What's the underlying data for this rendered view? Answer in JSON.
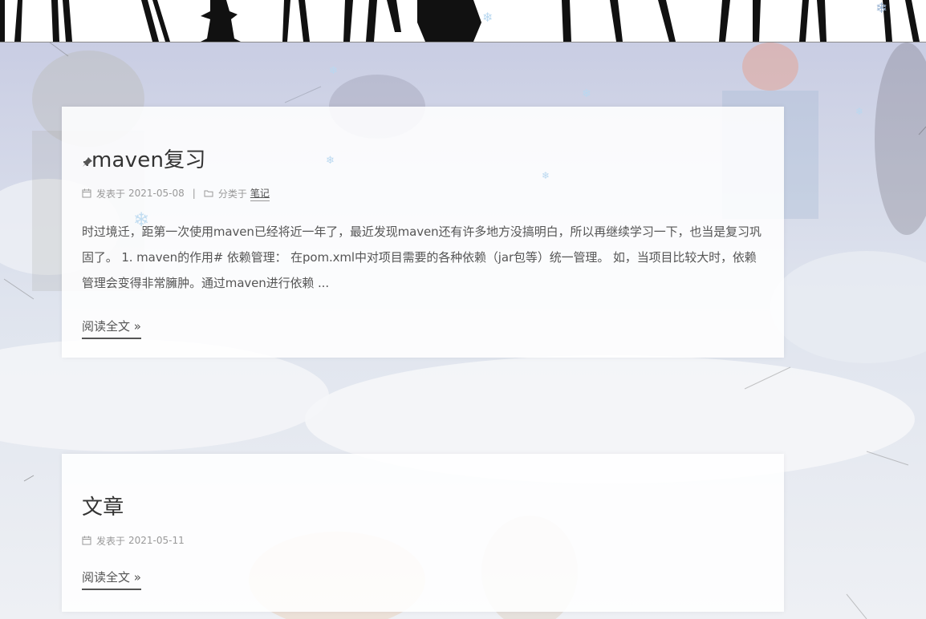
{
  "posts": [
    {
      "title": "maven复习",
      "pinned": true,
      "date_label": "发表于",
      "date": "2021-05-08",
      "category_label": "分类于",
      "category": "笔记",
      "excerpt": "时过境迁，距第一次使用maven已经将近一年了，最近发现maven还有许多地方没搞明白，所以再继续学习一下，也当是复习巩固了。 1. maven的作用# 依赖管理： 在pom.xml中对项目需要的各种依赖（jar包等）统一管理。 如，当项目比较大时，依赖管理会变得非常臃肿。通过maven进行依赖 ...",
      "read_more": "阅读全文 »"
    },
    {
      "title": "文章",
      "pinned": false,
      "date_label": "发表于",
      "date": "2021-05-11",
      "read_more": "阅读全文 »"
    }
  ],
  "icons": {
    "pin": "pushpin-icon",
    "calendar": "calendar-icon",
    "folder": "folder-icon",
    "snowflake": "snowflake-icon"
  },
  "colors": {
    "text": "#555555",
    "title": "#333333",
    "meta": "#999999",
    "snow": "#b9d8f0"
  },
  "meta_separator": "|",
  "snowflake_glyph": "❄"
}
